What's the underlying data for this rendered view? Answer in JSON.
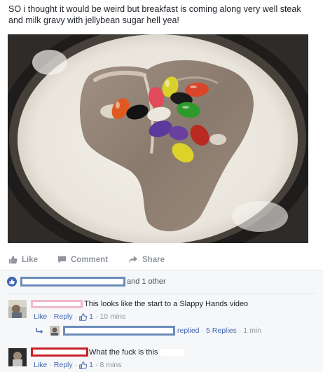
{
  "post": {
    "text": "SO i thought it would be weird but breakfast is coming along very well steak and milk gravy with jellybean sugar hell yea!"
  },
  "actions": {
    "like": "Like",
    "comment": "Comment",
    "share": "Share"
  },
  "reactions": {
    "others_text": "and 1 other"
  },
  "comments": [
    {
      "text": "This looks like the start to a Slappy Hands video",
      "like_label": "Like",
      "reply_label": "Reply",
      "like_count": "1",
      "time": "10 mins",
      "reply_summary": {
        "replied": "replied",
        "replies": "5 Replies",
        "time": "1 min"
      }
    },
    {
      "text": "What the fuck is this",
      "like_label": "Like",
      "reply_label": "Reply",
      "like_count": "1",
      "time": "8 mins"
    }
  ],
  "colors": {
    "link_blue": "#4267b2",
    "meta_gray": "#90949c",
    "redaction_blue": "#6b8cba",
    "redaction_pink": "#f0b9cb",
    "redaction_red": "#c8202a"
  },
  "icons": [
    "thumbs-up-icon",
    "comment-icon",
    "share-arrow-icon",
    "reply-arrow-icon"
  ]
}
